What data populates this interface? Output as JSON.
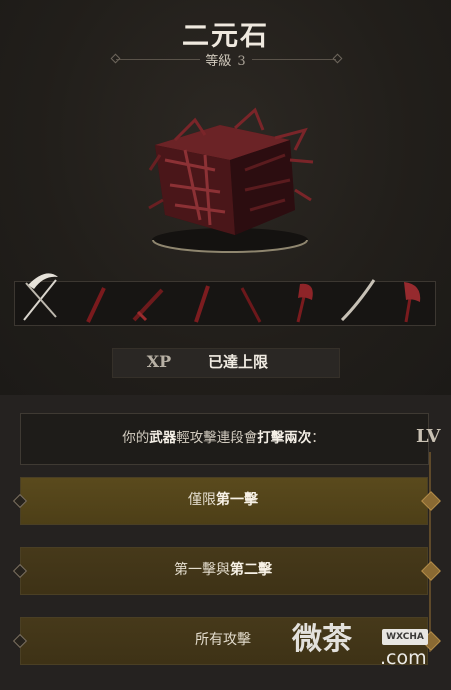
{
  "header": {
    "title": "二元石",
    "level_label": "等級",
    "level_value": "3"
  },
  "item": {
    "icon": "bloody-cube-icon",
    "weapons": [
      "scythe-icon",
      "dagger-icon",
      "sword-icon",
      "blade-icon",
      "spear-icon",
      "greataxe-icon",
      "katana-icon",
      "axe-icon"
    ]
  },
  "xp": {
    "badge": "XP",
    "status": "已達上限"
  },
  "upgrade": {
    "description_prefix": "你的",
    "description_bold1": "武器",
    "description_mid": "輕攻擊連段會",
    "description_bold2": "打擊兩次",
    "description_suffix": "：",
    "level_tag": "LV",
    "options": [
      {
        "pre": "僅限",
        "bold": "第一擊",
        "post": ""
      },
      {
        "pre": "第一擊與",
        "bold": "第二擊",
        "post": ""
      },
      {
        "pre": "所有攻擊",
        "bold": "",
        "post": ""
      }
    ]
  },
  "watermark": {
    "text": "微茶",
    "badge": "WXCHA",
    "domain": ".com"
  },
  "colors": {
    "background": "#201d19",
    "option_gold": "#5a4a1d",
    "accent": "#8a6a33"
  }
}
